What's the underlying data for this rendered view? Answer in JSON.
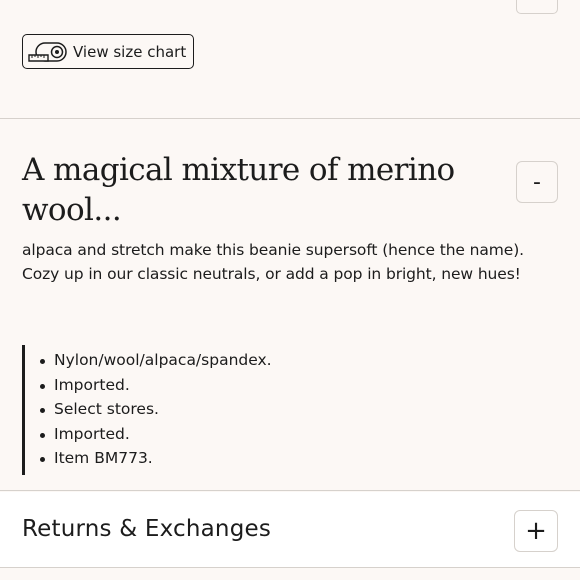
{
  "size_chart": {
    "label": "View size chart",
    "icon": "measuring-tape-icon"
  },
  "details": {
    "title": "A magical mixture of merino wool...",
    "toggle_label": "-",
    "description": "alpaca and stretch make this beanie supersoft (hence the name). Cozy up in our classic neutrals, or add a pop in bright, new hues!",
    "bullets": [
      "Nylon/wool/alpaca/spandex.",
      "Imported.",
      "Select stores.",
      "Imported.",
      "Item BM773."
    ]
  },
  "returns": {
    "title": "Returns & Exchanges",
    "toggle_label": "+"
  },
  "colors": {
    "background": "#fcf8f5",
    "text": "#1c1c1c",
    "divider": "#d6d1cc",
    "returns_bg": "#ffffff"
  }
}
